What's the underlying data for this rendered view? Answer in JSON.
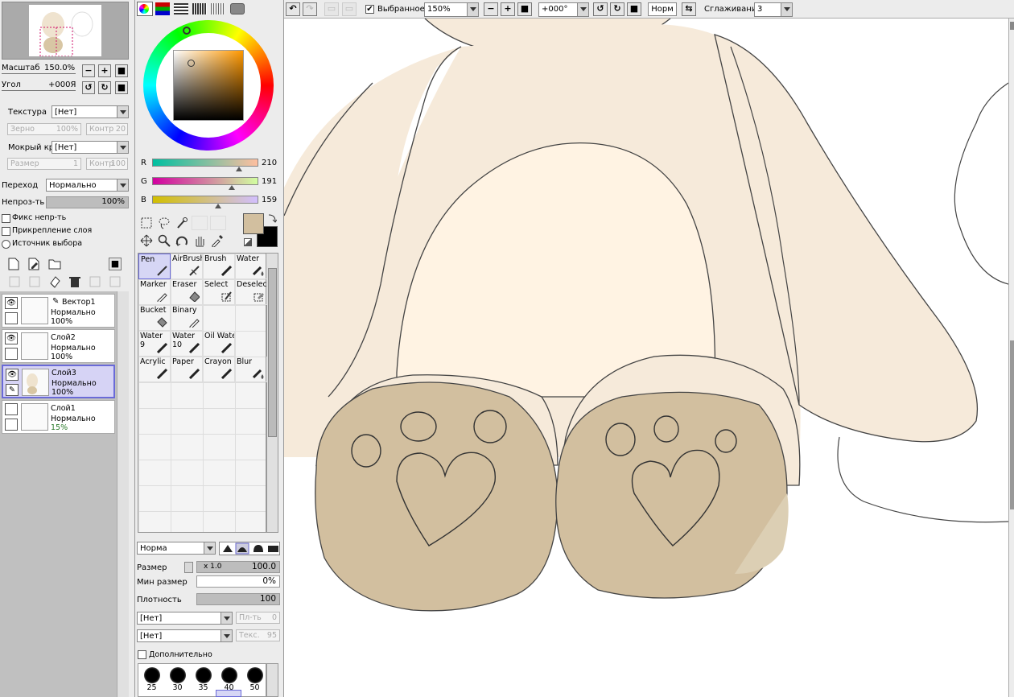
{
  "navigator": {
    "zoom_label": "Масштаб",
    "zoom_value": "150.0%",
    "angle_label": "Угол",
    "angle_value": "+000Я"
  },
  "texture": {
    "label": "Текстура",
    "value": "[Нет]",
    "grain_label": "Зерно",
    "grain_value": "100%",
    "contrast_label": "Контр",
    "contrast_value": "20"
  },
  "wet_edge": {
    "label": "Мокрый край",
    "value": "[Нет]",
    "size_label": "Размер",
    "size_value": "1",
    "contrast_label": "Контр",
    "contrast_value": "100"
  },
  "blend": {
    "label": "Переход",
    "value": "Нормально"
  },
  "opacity": {
    "label": "Непроз-ть",
    "value": "100%"
  },
  "options": {
    "fix_opacity": "Фикс непр-ть",
    "clip_layer": "Прикрепление слоя",
    "selection_source": "Источник выбора"
  },
  "layers": [
    {
      "name": "Вектор1",
      "mode": "Нормально",
      "opacity": "100%"
    },
    {
      "name": "Слой2",
      "mode": "Нормально",
      "opacity": "100%"
    },
    {
      "name": "Слой3",
      "mode": "Нормально",
      "opacity": "100%"
    },
    {
      "name": "Слой1",
      "mode": "Нормально",
      "opacity": "15%"
    }
  ],
  "color": {
    "r_label": "R",
    "r": "210",
    "g_label": "G",
    "g": "191",
    "b_label": "B",
    "b": "159",
    "primary": "#d2bf9f",
    "secondary": "#000000",
    "r_frac": 0.82,
    "g_frac": 0.75,
    "b_frac": 0.62
  },
  "tools": [
    {
      "name": "Pen"
    },
    {
      "name": "AirBrush"
    },
    {
      "name": "Brush"
    },
    {
      "name": "Water"
    },
    {
      "name": "Marker"
    },
    {
      "name": "Eraser"
    },
    {
      "name": "Select"
    },
    {
      "name": "Deselect"
    },
    {
      "name": "Bucket"
    },
    {
      "name": "Binary"
    },
    {
      "name": "Water",
      "sub": "9"
    },
    {
      "name": "Water",
      "sub": "10"
    },
    {
      "name": "Oil Water"
    },
    {
      "name": "",
      "sub": ""
    },
    {
      "name": "Acrylic"
    },
    {
      "name": "Paper"
    },
    {
      "name": "Crayon"
    },
    {
      "name": "Blur"
    }
  ],
  "brush_settings": {
    "mode": "Норма",
    "size_label": "Размер",
    "size_mult": "x 1.0",
    "size_value": "100.0",
    "min_size_label": "Мин размер",
    "min_size_value": "0%",
    "density_label": "Плотность",
    "density_value": "100",
    "tex1": "[Нет]",
    "tex1_field": "Пл-ть",
    "tex1_num": "0",
    "tex2": "[Нет]",
    "tex2_field": "Текс.",
    "tex2_num": "95",
    "extra_label": "Дополнительно"
  },
  "brush_sizes": [
    "25",
    "30",
    "35",
    "40",
    "50"
  ],
  "toolbar": {
    "selected_label": "Выбранное",
    "zoom": "150%",
    "angle": "+000°",
    "norm": "Норм",
    "smoothing_label": "Сглаживание",
    "smoothing_value": "3"
  }
}
